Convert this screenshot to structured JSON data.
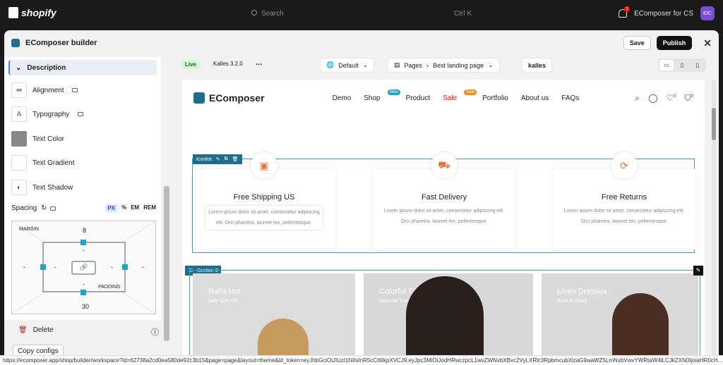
{
  "topbar": {
    "brand": "shopify",
    "search_placeholder": "Search",
    "search_shortcut": "Ctrl K",
    "notif_count": "1",
    "store_name": "EComposer for CS",
    "avatar_initials": "EfC"
  },
  "builder": {
    "title": "EComposer builder",
    "save_label": "Save",
    "publish_label": "Publish"
  },
  "panel": {
    "section_title": "Description",
    "rows": [
      {
        "label": "Alignment"
      },
      {
        "label": "Typography"
      },
      {
        "label": "Text Color"
      },
      {
        "label": "Text Gradient"
      },
      {
        "label": "Text Shadow"
      }
    ],
    "spacing_label": "Spacing",
    "units": [
      "PX",
      "%",
      "EM",
      "REM"
    ],
    "margin_label": "MARGIN",
    "padding_label": "PADDING",
    "margin_top": "8",
    "margin_bottom": "30",
    "margin_left": "-",
    "margin_right": "-",
    "padding_top": "-",
    "padding_bottom": "-",
    "padding_left": "-",
    "padding_right": "-",
    "delete_label": "Delete",
    "copy_label": "Copy configs"
  },
  "canvas_toolbar": {
    "live_label": "Live",
    "theme_version": "Kalles 3.2.0",
    "more": "...",
    "default_label": "Default",
    "pages_label": "Pages",
    "page_name": "Best landing page",
    "theme_logo": "kalles"
  },
  "site": {
    "brand": "EComposer",
    "nav": [
      {
        "label": "Demo"
      },
      {
        "label": "Shop",
        "badge": "New"
      },
      {
        "label": "Product"
      },
      {
        "label": "Sale",
        "badge": "Sale"
      },
      {
        "label": "Portfolio"
      },
      {
        "label": "About us"
      },
      {
        "label": "FAQs"
      }
    ],
    "wishlist_count": "0",
    "cart_count": "0",
    "iconlist_tag": "Iconlist",
    "features": [
      {
        "title": "Free Shipping US",
        "text": "Lorem ipsum dolor sit amet, consectetur adipiscing elit. Orci pharetra, laoreet leo, pellentesque."
      },
      {
        "title": "Fast Delivery",
        "text": "Lorem ipsum dolor sit amet, consectetur adipiscing elit. Orci pharetra, laoreet leo, pellentesque."
      },
      {
        "title": "Free Returns",
        "text": "Lorem ipsum dolor sit amet, consectetur adipiscing elit. Orci pharetra, laoreet leo, pellentesque."
      }
    ],
    "section3_tag": "Section 3",
    "products": [
      {
        "title": "Rafia Hat",
        "sub": "Sale 50% Off"
      },
      {
        "title": "Colorful TShirt",
        "sub": "Summer Trending"
      },
      {
        "title": "Linen Dresses",
        "sub": "Back In Stock"
      }
    ]
  },
  "status_url": "https://ecomposer.app/shop/builder/workspace?id=62738a2cd0ea580de92c3b15&page=page&layout=theme&id_token=eyJhbGciOiJIUzI1NiIsInR5cCI6IkpXVCJ9.eyJpc3MiOiJodHRwczpcL1wvZWNvbXBvc2VyLXRlc3RpbmcubXlzaG9waWZ5LmNvbVwvYWRtaW4iLCJkZXN0IjoiaHR0cH..."
}
